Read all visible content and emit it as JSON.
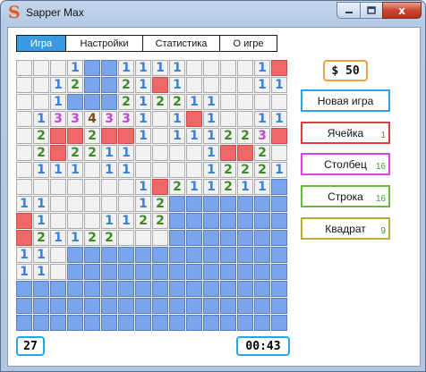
{
  "window": {
    "title": "Sapper Max",
    "icon_letter": "S",
    "close_glyph": "x"
  },
  "tabs": [
    {
      "label": "Игра",
      "active": true
    },
    {
      "label": "Настройки",
      "active": false
    },
    {
      "label": "Статистика",
      "active": false
    },
    {
      "label": "О игре",
      "active": false
    }
  ],
  "board": {
    "rows": [
      [
        "o",
        "o",
        "o",
        "1",
        "c",
        "c",
        "1",
        "1",
        "1",
        "1",
        "o",
        "o",
        "o",
        "o",
        "1",
        "m"
      ],
      [
        "o",
        "o",
        "1",
        "2",
        "c",
        "c",
        "2",
        "1",
        "m",
        "1",
        "o",
        "o",
        "o",
        "o",
        "1",
        "1"
      ],
      [
        "o",
        "o",
        "1",
        "c",
        "c",
        "c",
        "2",
        "1",
        "2",
        "2",
        "1",
        "1",
        "o",
        "o",
        "o",
        "o"
      ],
      [
        "o",
        "1",
        "3",
        "3",
        "4",
        "3",
        "3",
        "1",
        "o",
        "1",
        "m",
        "1",
        "o",
        "o",
        "1",
        "1"
      ],
      [
        "o",
        "2",
        "m",
        "m",
        "2",
        "m",
        "m",
        "1",
        "o",
        "1",
        "1",
        "1",
        "2",
        "2",
        "3",
        "m"
      ],
      [
        "o",
        "2",
        "m",
        "2",
        "2",
        "1",
        "1",
        "o",
        "o",
        "o",
        "o",
        "1",
        "m",
        "m",
        "2",
        "o"
      ],
      [
        "o",
        "1",
        "1",
        "1",
        "o",
        "1",
        "1",
        "o",
        "o",
        "o",
        "o",
        "1",
        "2",
        "2",
        "2",
        "1"
      ],
      [
        "o",
        "o",
        "o",
        "o",
        "o",
        "o",
        "o",
        "1",
        "m",
        "2",
        "1",
        "1",
        "2",
        "1",
        "1",
        "c"
      ],
      [
        "1",
        "1",
        "o",
        "o",
        "o",
        "o",
        "o",
        "1",
        "2",
        "c",
        "c",
        "c",
        "c",
        "c",
        "c",
        "c"
      ],
      [
        "m",
        "1",
        "o",
        "o",
        "o",
        "1",
        "1",
        "2",
        "2",
        "c",
        "c",
        "c",
        "c",
        "c",
        "c",
        "c"
      ],
      [
        "m",
        "2",
        "1",
        "1",
        "2",
        "2",
        "o",
        "o",
        "o",
        "c",
        "c",
        "c",
        "c",
        "c",
        "c",
        "c"
      ],
      [
        "1",
        "1",
        "o",
        "c",
        "c",
        "c",
        "c",
        "c",
        "c",
        "c",
        "c",
        "c",
        "c",
        "c",
        "c",
        "c"
      ],
      [
        "1",
        "1",
        "o",
        "c",
        "c",
        "c",
        "c",
        "c",
        "c",
        "c",
        "c",
        "c",
        "c",
        "c",
        "c",
        "c"
      ],
      [
        "c",
        "c",
        "c",
        "c",
        "c",
        "c",
        "c",
        "c",
        "c",
        "c",
        "c",
        "c",
        "c",
        "c",
        "c",
        "c"
      ],
      [
        "c",
        "c",
        "c",
        "c",
        "c",
        "c",
        "c",
        "c",
        "c",
        "c",
        "c",
        "c",
        "c",
        "c",
        "c",
        "c"
      ],
      [
        "c",
        "c",
        "c",
        "c",
        "c",
        "c",
        "c",
        "c",
        "c",
        "c",
        "c",
        "c",
        "c",
        "c",
        "c",
        "c"
      ]
    ],
    "colors": {
      "closed": "#7aa4ec",
      "open": "#f1f1f1",
      "mine": "#ef6767",
      "n1": "#3a7fd7",
      "n2": "#3e8a27",
      "n3": "#c346d6",
      "n4": "#7a4a11"
    }
  },
  "money": "$ 50",
  "actions": {
    "new_game": {
      "label": "Новая игра"
    },
    "cell": {
      "label": "Ячейка",
      "price": "1"
    },
    "column": {
      "label": "Столбец",
      "price": "16"
    },
    "row": {
      "label": "Строка",
      "price": "16"
    },
    "square": {
      "label": "Квадрат",
      "price": "9"
    }
  },
  "status": {
    "counter": "27",
    "timer": "00:43"
  }
}
